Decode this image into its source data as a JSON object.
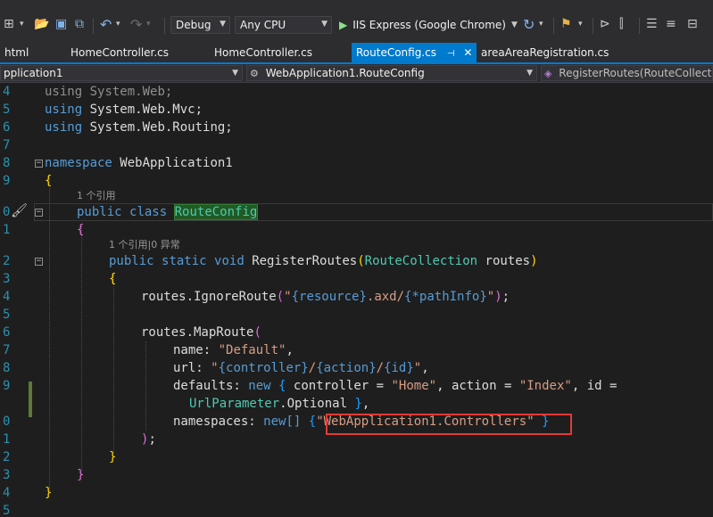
{
  "toolbar": {
    "config": "Debug",
    "platform": "Any CPU",
    "run_target": "IIS Express (Google Chrome)"
  },
  "tabs": [
    {
      "label": "html"
    },
    {
      "label": "HomeController.cs"
    },
    {
      "label": "HomeController.cs"
    },
    {
      "label": "RouteConfig.cs",
      "active": true
    },
    {
      "label": "areaAreaRegistration.cs"
    }
  ],
  "navbar": {
    "project": "pplication1",
    "type": "WebApplication1.RouteConfig",
    "member": "RegisterRoutes(RouteCollection"
  },
  "codelens": {
    "class_refs": "1 个引用",
    "method_refs": "1 个引用|0 异常"
  },
  "line_numbers": [
    "4",
    "5",
    "6",
    "7",
    "8",
    "9",
    "",
    "0",
    "1",
    "",
    "2",
    "3",
    "4",
    "5",
    "6",
    "7",
    "8",
    "9",
    "",
    "0",
    "1",
    "2",
    "3",
    "4",
    "5"
  ],
  "code": {
    "using1": "System.Web;",
    "using2": "System.Web.Mvc;",
    "using3": "System.Web.Routing;",
    "kw_using": "using",
    "kw_namespace": "namespace",
    "ns_name": "WebApplication1",
    "kw_public": "public",
    "kw_class": "class",
    "class_name": "RouteConfig",
    "kw_static": "static",
    "kw_void": "void",
    "method_name": "RegisterRoutes",
    "param_type": "RouteCollection",
    "param_name": "routes",
    "ignore_call": "routes.IgnoreRoute",
    "ignore_str_1": "\"",
    "ignore_fmt_1": "{resource}",
    "ignore_str_2": ".axd/",
    "ignore_fmt_2": "{*pathInfo}",
    "ignore_str_3": "\"",
    "maproute_call": "routes.MapRoute",
    "name_label": "name:",
    "name_value": "\"Default\"",
    "url_label": "url:",
    "url_q1": "\"",
    "url_fmt_1": "{controller}",
    "url_slash_1": "/",
    "url_fmt_2": "{action}",
    "url_slash_2": "/",
    "url_fmt_3": "{id}",
    "url_q2": "\"",
    "defaults_label": "defaults:",
    "kw_new": "new",
    "controller_key": "controller =",
    "controller_value": "\"Home\"",
    "action_key": "action =",
    "action_value": "\"Index\"",
    "id_key": "id =",
    "urlparameter": "UrlParameter",
    "optional": ".Optional",
    "namespaces_label": "namespaces:",
    "kw_new_arr": "new[]",
    "namespaces_value": "\"WebApplication1.Controllers\""
  }
}
